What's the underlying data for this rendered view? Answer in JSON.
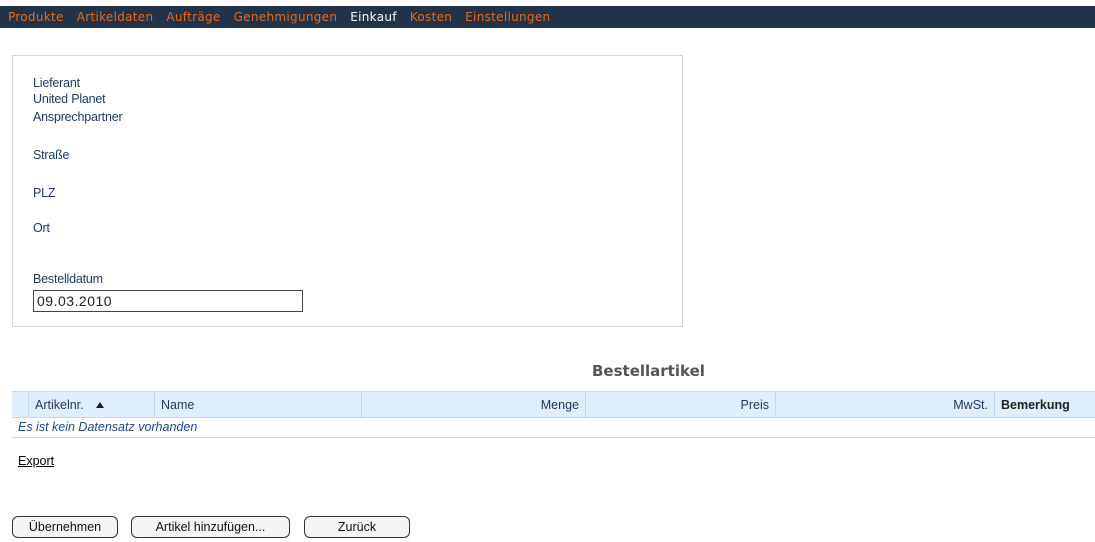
{
  "nav": {
    "items": [
      {
        "label": "Produkte",
        "active": false
      },
      {
        "label": "Artikeldaten",
        "active": false
      },
      {
        "label": "Aufträge",
        "active": false
      },
      {
        "label": "Genehmigungen",
        "active": false
      },
      {
        "label": "Einkauf",
        "active": true
      },
      {
        "label": "Kosten",
        "active": false
      },
      {
        "label": "Einstellungen",
        "active": false
      }
    ],
    "colors": {
      "bar": "#223349",
      "link": "#e06a1c",
      "active": "#ffffff"
    }
  },
  "supplier": {
    "lieferant_label": "Lieferant",
    "lieferant_value": "United Planet",
    "ansprechpartner_label": "Ansprechpartner",
    "strasse_label": "Straße",
    "plz_label": "PLZ",
    "ort_label": "Ort",
    "bestelldatum_label": "Bestelldatum",
    "bestelldatum_value": "09.03.2010"
  },
  "grid": {
    "title": "Bestellartikel",
    "columns": {
      "artikelnr": "Artikelnr.",
      "name": "Name",
      "menge": "Menge",
      "preis": "Preis",
      "mwst": "MwSt.",
      "bemerkung": "Bemerkung"
    },
    "empty_message": "Es ist kein Datensatz vorhanden"
  },
  "export_label": "Export",
  "buttons": {
    "uebernehmen": "Übernehmen",
    "artikel_hinzufuegen": "Artikel hinzufügen...",
    "zurueck": "Zurück"
  }
}
